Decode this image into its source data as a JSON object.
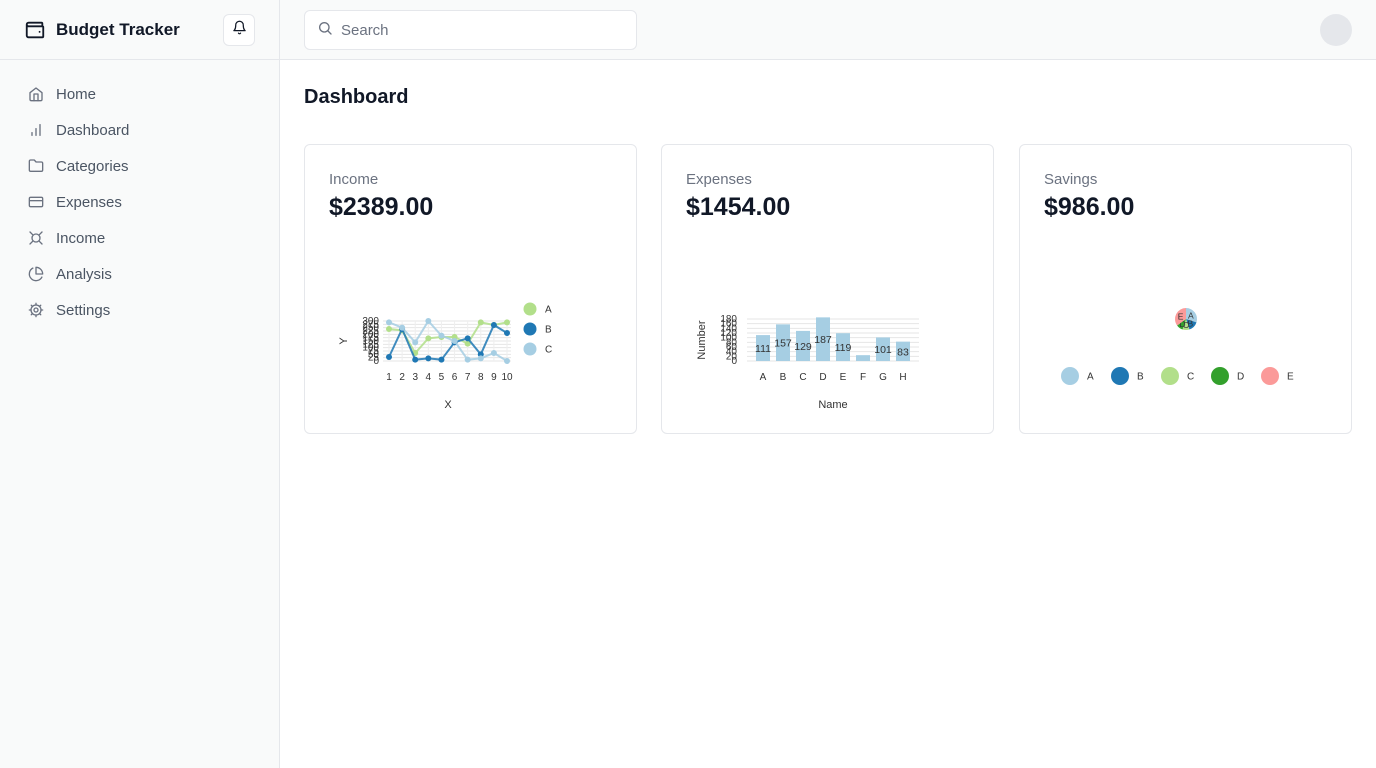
{
  "app": {
    "title": "Budget Tracker"
  },
  "icons": {
    "brand": "wallet-icon",
    "notifications": "bell-icon",
    "search": "search-icon"
  },
  "sidebar": {
    "items": [
      {
        "label": "Home",
        "icon": "home-icon"
      },
      {
        "label": "Dashboard",
        "icon": "bar-chart-icon"
      },
      {
        "label": "Categories",
        "icon": "folder-icon"
      },
      {
        "label": "Expenses",
        "icon": "credit-card-icon"
      },
      {
        "label": "Income",
        "icon": "income-icon"
      },
      {
        "label": "Analysis",
        "icon": "pie-chart-icon"
      },
      {
        "label": "Settings",
        "icon": "gear-icon"
      }
    ]
  },
  "search": {
    "placeholder": "Search",
    "value": ""
  },
  "page": {
    "title": "Dashboard"
  },
  "cards": {
    "income": {
      "label": "Income",
      "amount": "$2389.00"
    },
    "expenses": {
      "label": "Expenses",
      "amount": "$1454.00"
    },
    "savings": {
      "label": "Savings",
      "amount": "$986.00"
    }
  },
  "colors": {
    "A": "#a6cee3",
    "B": "#1f78b4",
    "C": "#b2df8a",
    "D": "#33a02c",
    "E": "#fb9a99",
    "lineA": "#b2df8a",
    "lineB": "#1f78b4",
    "lineC": "#a6cee3"
  },
  "chart_data": [
    {
      "type": "line",
      "xlabel": "X",
      "ylabel": "Y",
      "x": [
        1,
        2,
        3,
        4,
        5,
        6,
        7,
        8,
        9,
        10
      ],
      "ylim": [
        0,
        300
      ],
      "yticks": [
        0,
        25,
        50,
        75,
        100,
        125,
        150,
        175,
        200,
        225,
        250,
        275,
        300
      ],
      "series": [
        {
          "name": "A",
          "values": [
            240,
            230,
            60,
            170,
            180,
            180,
            130,
            290,
            270,
            290
          ]
        },
        {
          "name": "B",
          "values": [
            30,
            240,
            10,
            20,
            10,
            140,
            170,
            50,
            270,
            210
          ]
        },
        {
          "name": "C",
          "values": [
            290,
            250,
            140,
            300,
            190,
            150,
            10,
            20,
            60,
            0
          ]
        }
      ],
      "legend": "right"
    },
    {
      "type": "bar",
      "xlabel": "Name",
      "ylabel": "Number",
      "categories": [
        "A",
        "B",
        "C",
        "D",
        "E",
        "F",
        "G",
        "H"
      ],
      "values": [
        111,
        157,
        129,
        187,
        119,
        25,
        101,
        83
      ],
      "data_labels": [
        "111",
        "157",
        "129",
        "187",
        "119",
        "",
        "101",
        "83"
      ],
      "ylim": [
        0,
        180
      ],
      "yticks": [
        0,
        20,
        40,
        60,
        80,
        100,
        120,
        140,
        160,
        180
      ]
    },
    {
      "type": "pie",
      "categories": [
        "A",
        "B",
        "C",
        "D",
        "E"
      ],
      "values": [
        30,
        15,
        10,
        10,
        35
      ],
      "legend": "bottom"
    }
  ]
}
